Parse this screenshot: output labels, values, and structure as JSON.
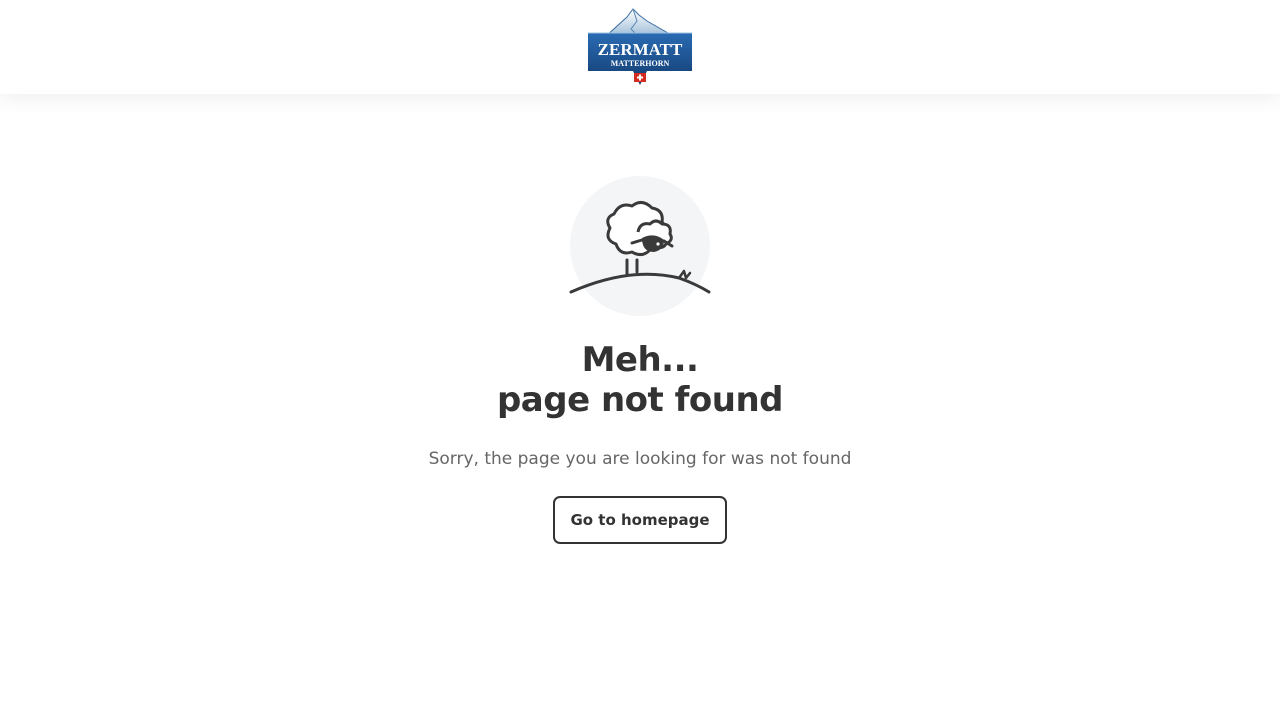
{
  "header": {
    "logo": {
      "line1": "ZERMATT",
      "line2": "MATTERHORN",
      "icon": "matterhorn-logo"
    }
  },
  "main": {
    "illustration": {
      "icon": "sheep-on-hill-icon"
    },
    "heading_line1": "Meh...",
    "heading_line2": "page not found",
    "subtitle": "Sorry, the page you are looking for was not found",
    "button_label": "Go to homepage"
  },
  "colors": {
    "text_dark": "#333333",
    "text_muted": "#666666",
    "illustration_bg": "#f4f5f7",
    "logo_blue": "#1c4f8c"
  }
}
